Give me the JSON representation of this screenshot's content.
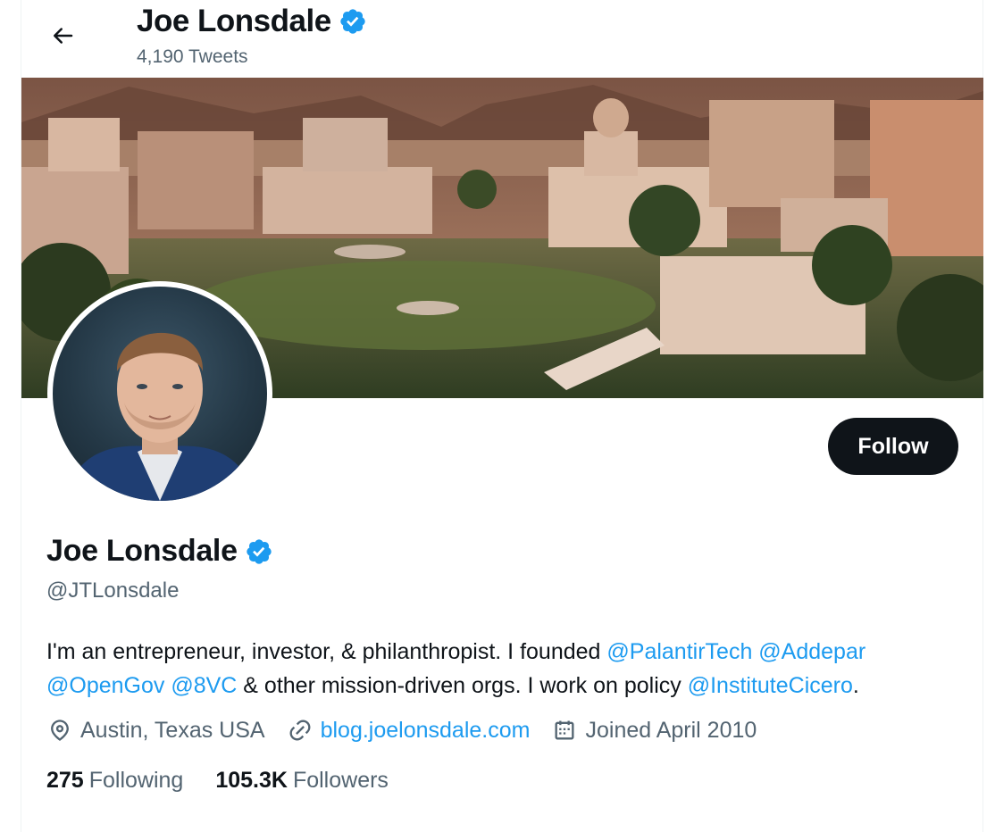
{
  "header": {
    "name": "Joe Lonsdale",
    "tweets_count": "4,190 Tweets"
  },
  "profile": {
    "display_name": "Joe Lonsdale",
    "handle": "@JTLonsdale",
    "follow_label": "Follow",
    "bio": {
      "text1": "I'm an entrepreneur, investor, & philanthropist. I founded ",
      "mention1": "@PalantirTech",
      "mention2": "@Addepar",
      "mention3": "@OpenGov",
      "mention4": "@8VC",
      "text2": " & other mission-driven orgs. I work on policy ",
      "mention5": "@InstituteCicero",
      "text3": "."
    },
    "location": "Austin, Texas USA",
    "website": "blog.joelonsdale.com",
    "joined": "Joined April 2010",
    "following_count": "275",
    "following_label": "Following",
    "followers_count": "105.3K",
    "followers_label": "Followers"
  },
  "colors": {
    "accent": "#1d9bf0",
    "text_primary": "#0f1419",
    "text_secondary": "#536471",
    "button_bg": "#0f1419"
  },
  "icons": {
    "back": "arrow-left-icon",
    "verified": "verified-badge-icon",
    "location": "location-pin-icon",
    "website": "link-icon",
    "joined": "calendar-icon"
  }
}
